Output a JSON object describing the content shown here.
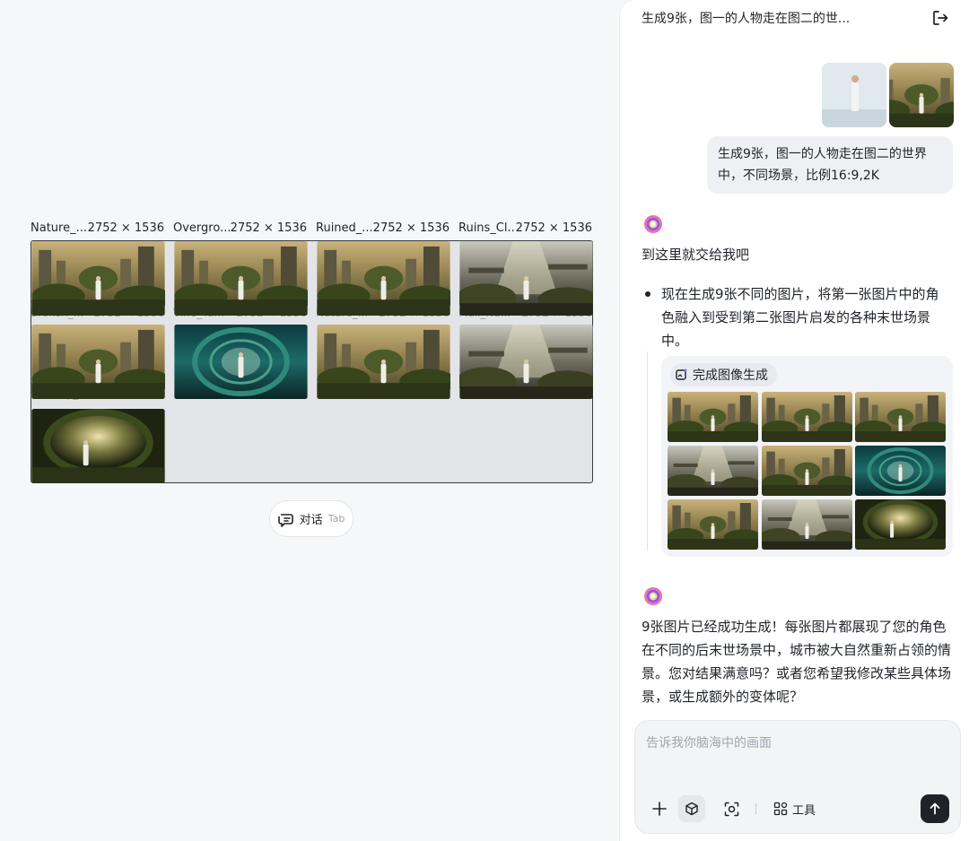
{
  "canvas": {
    "tile_labels": [
      {
        "name": "Nature_...",
        "size": "2752 × 1536"
      },
      {
        "name": "Overgro...",
        "size": "2752 × 1536"
      },
      {
        "name": "Ruined_...",
        "size": "2752 × 1536"
      },
      {
        "name": "Ruins_Cl...",
        "size": "2752 × 1536"
      }
    ],
    "ghost_labels": [
      {
        "name": "Broken_...",
        "size": "2752 × 1536"
      },
      {
        "name": "Vine_Tu...",
        "size": "2752 × 1536"
      },
      {
        "name": "Nature_...",
        "size": "2752 × 1536"
      },
      {
        "name": "Mall_Na...",
        "size": "2752 × 1536"
      },
      {
        "name": "Subway_...",
        "size": "2752 × 1536"
      }
    ],
    "tab_chip": {
      "label": "对话",
      "key": "Tab"
    }
  },
  "chat": {
    "title": "生成9张，图一的人物走在图二的世...",
    "user_message": "生成9张，图一的人物走在图二的世界中，不同场景，比例16:9,2K",
    "bot_intro": "到这里就交给我吧",
    "bullet": "现在生成9张不同的图片，将第一张图片中的角色融入到受到第二张图片启发的各种末世场景中。",
    "done_chip": "完成图像生成",
    "bot_final": "9张图片已经成功生成！每张图片都展现了您的角色在不同的后末世场景中，城市被大自然重新占领的情景。您对结果满意吗？或者您希望我修改某些具体场景，或生成额外的变体呢？",
    "input_placeholder": "告诉我你脑海中的画面",
    "tools_label": "工具"
  }
}
